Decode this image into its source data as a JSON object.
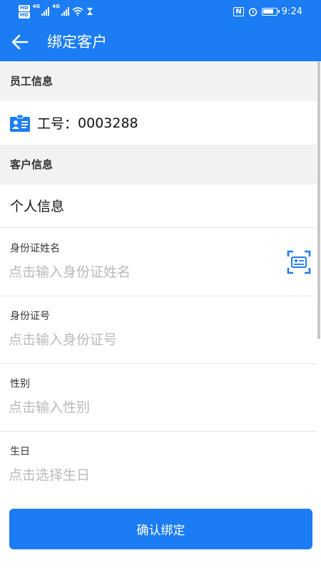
{
  "status_bar": {
    "hd1": "HD",
    "hd2": "HD",
    "net1": "4G",
    "net2": "4G",
    "time": "9:24",
    "nfc": "N"
  },
  "app_bar": {
    "title": "绑定客户"
  },
  "employee_section": {
    "title": "员工信息",
    "id_label": "工号：",
    "id_value": "0003288"
  },
  "customer_section": {
    "title": "客户信息",
    "subtitle": "个人信息",
    "fields": [
      {
        "label": "身份证姓名",
        "placeholder": "点击输入身份证姓名",
        "value": ""
      },
      {
        "label": "身份证号",
        "placeholder": "点击输入身份证号",
        "value": ""
      },
      {
        "label": "性别",
        "placeholder": "点击输入性别",
        "value": ""
      },
      {
        "label": "生日",
        "placeholder": "点击选择生日",
        "value": ""
      }
    ]
  },
  "confirm_button": {
    "label": "确认绑定"
  },
  "colors": {
    "primary": "#1b7cf4",
    "section_bg": "#f2f2f2",
    "placeholder": "#b9b9bf"
  },
  "icons": {
    "back": "arrow-left-icon",
    "employee": "id-card-icon",
    "scan": "id-scan-icon",
    "wifi": "wifi-icon",
    "hourglass": "hourglass-icon",
    "alarm": "alarm-icon",
    "battery": "battery-icon"
  }
}
